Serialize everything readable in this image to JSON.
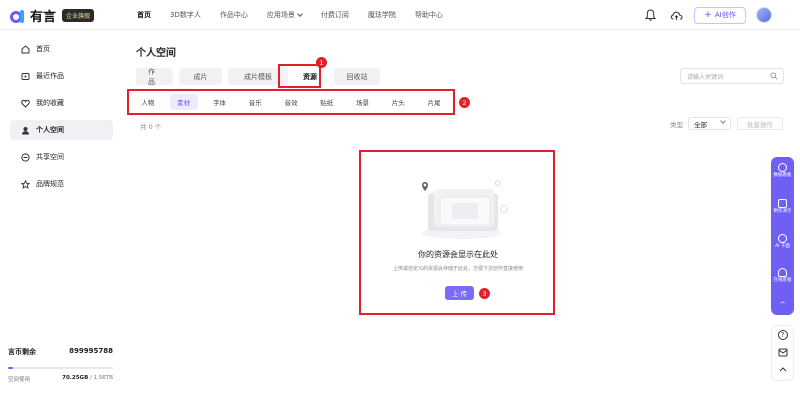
{
  "app": {
    "logo_text": "有言",
    "badge": "企业旗舰"
  },
  "nav": [
    {
      "label": "首页"
    },
    {
      "label": "3D数字人"
    },
    {
      "label": "作品中心"
    },
    {
      "label": "应用场景"
    },
    {
      "label": "付费订阅"
    },
    {
      "label": "魔珐学院"
    },
    {
      "label": "帮助中心"
    }
  ],
  "header": {
    "ai_button": "AI创作"
  },
  "sidebar": {
    "items": [
      {
        "label": "首页",
        "icon": "home-icon"
      },
      {
        "label": "最近作品",
        "icon": "recent-icon"
      },
      {
        "label": "我的收藏",
        "icon": "heart-icon"
      },
      {
        "label": "个人空间",
        "icon": "user-icon"
      },
      {
        "label": "共享空间",
        "icon": "share-icon"
      },
      {
        "label": "品牌规范",
        "icon": "star-icon"
      }
    ],
    "coins_label": "言币剩余",
    "coins_value": "899995788",
    "space_label": "空间使用",
    "space_used": "70.25GB",
    "space_total": "/ 1.56TB",
    "space_fraction": 0.045
  },
  "main": {
    "title": "个人空间",
    "tabs": [
      "作品",
      "成片",
      "成片模板",
      "资源",
      "回收站"
    ],
    "search_placeholder": "请输入关键词",
    "subtabs": [
      "人物",
      "素材",
      "字体",
      "音乐",
      "音效",
      "贴纸",
      "场景",
      "片头",
      "片尾"
    ],
    "count": "共 0 个",
    "type_label": "类型",
    "type_value": "全部",
    "batch_label": "批量操作",
    "empty_title": "你的资源会显示在此处",
    "empty_desc": "上传或自定义的资源会存储于此处，方便下次创作直接使用",
    "upload_label": "上 传"
  },
  "markers": [
    "1",
    "2",
    "3"
  ],
  "float": {
    "items": [
      "数据看板",
      "制作演示",
      "AI 千面",
      "在线客服"
    ],
    "up": "^",
    "help": "?"
  },
  "colors": {
    "accent": "#6f5ff3",
    "highlight": "#e0202a"
  }
}
